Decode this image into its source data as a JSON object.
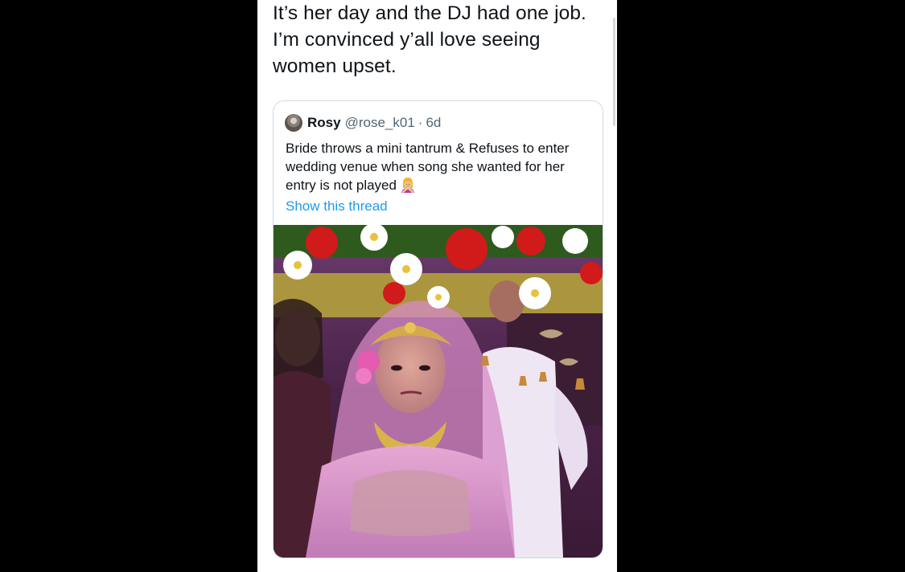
{
  "tweet": {
    "text_lines": [
      "It’s her day and the DJ had one job.",
      "I’m convinced y’all love seeing",
      "women upset."
    ]
  },
  "quoted_tweet": {
    "display_name": "Rosy",
    "handle": "@rose_k01",
    "separator": "·",
    "time": "6d",
    "text_lines": [
      "Bride throws a mini tantrum & Refuses to enter",
      "wedding venue when song she wanted for her",
      "entry is not played"
    ],
    "emoji": "woman-gesturing-no-emoji",
    "show_thread_label": "Show this thread"
  },
  "colors": {
    "background": "#000000",
    "panel": "#ffffff",
    "text": "#0f1419",
    "secondary_text": "#536471",
    "link": "#1d9bf0",
    "card_border": "#cfd9de"
  }
}
